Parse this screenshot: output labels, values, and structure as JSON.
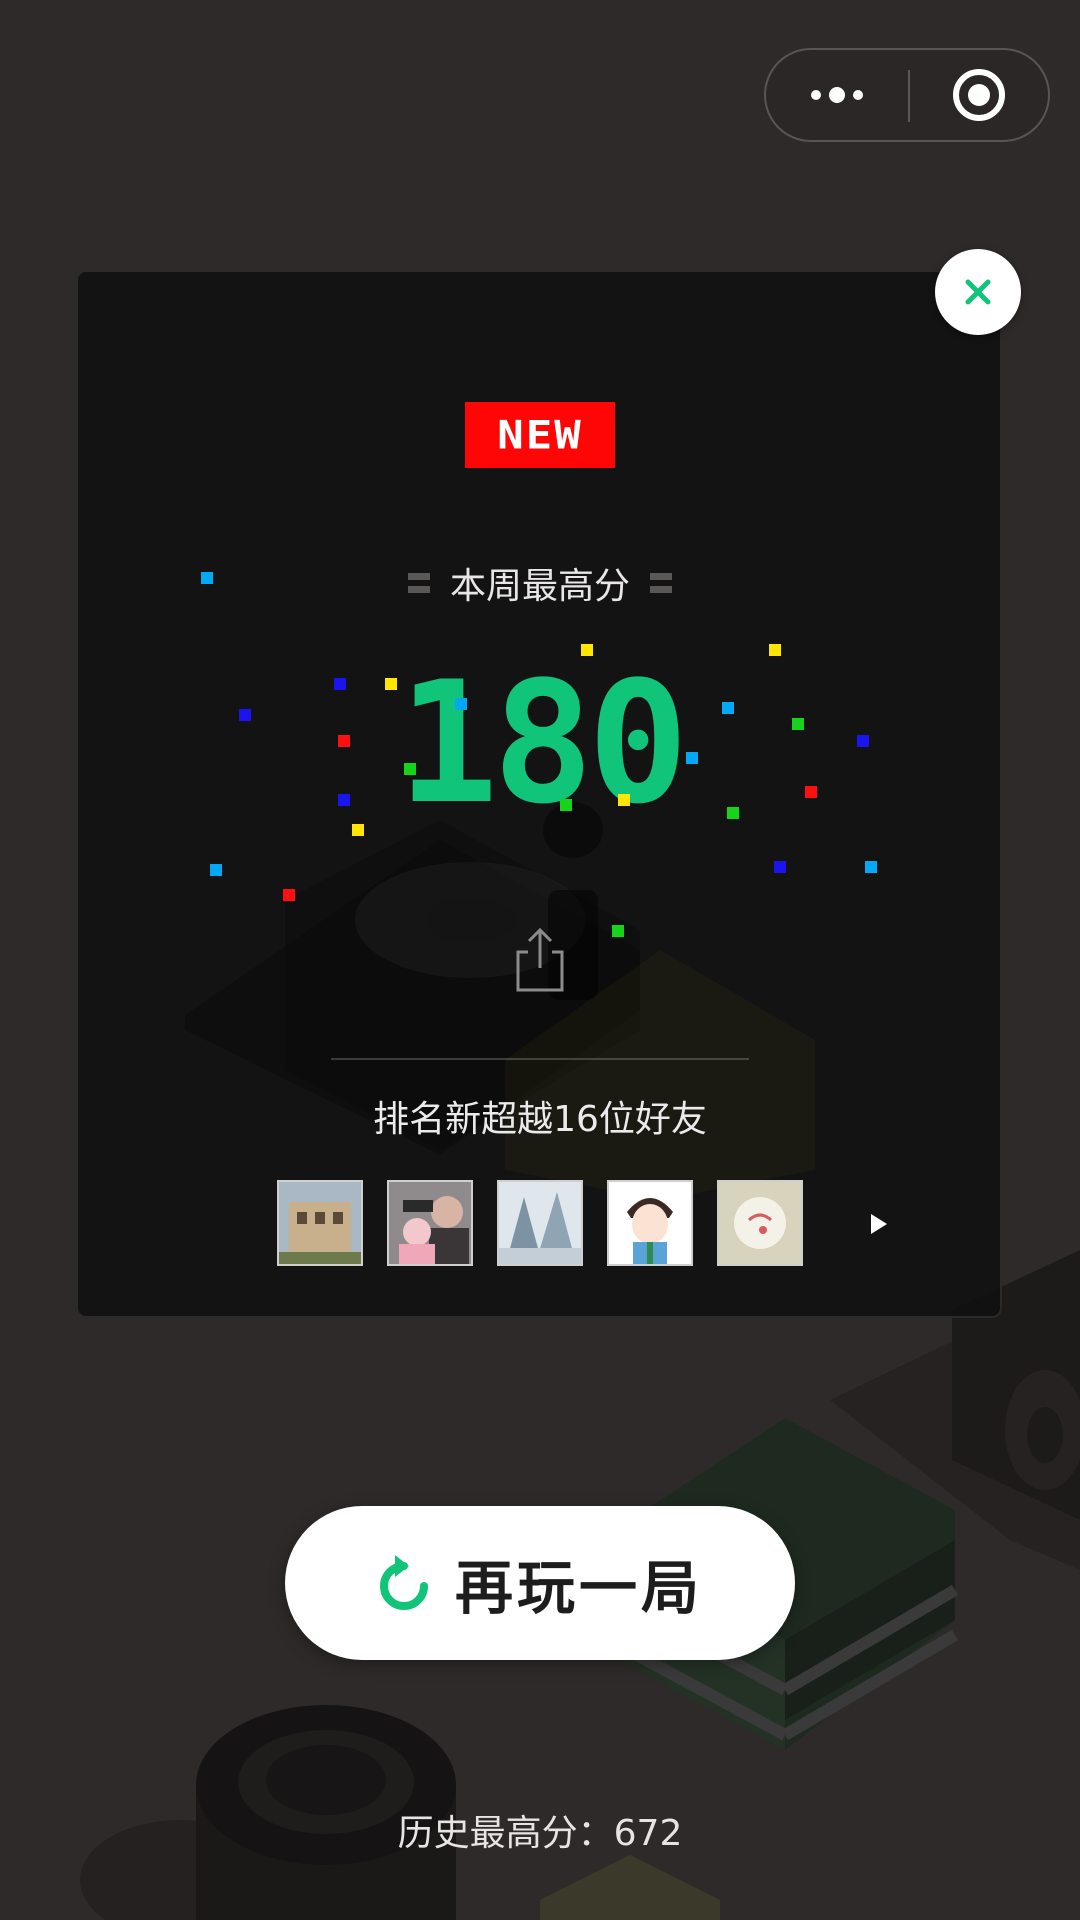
{
  "capsule": {
    "more_icon": "more-dots-icon",
    "target_icon": "target-icon"
  },
  "panel": {
    "close_icon": "close-icon",
    "new_badge": "NEW",
    "subtitle": "本周最高分",
    "score": "180",
    "share_icon": "share-icon",
    "rank_text": "排名新超越16位好友",
    "friends": [
      {
        "name": "friend-avatar-1",
        "colors": [
          "#9aa58a",
          "#c7b394",
          "#6c6f52"
        ]
      },
      {
        "name": "friend-avatar-2",
        "colors": [
          "#3d3a3c",
          "#f0c4c8",
          "#8a8486"
        ]
      },
      {
        "name": "friend-avatar-3",
        "colors": [
          "#cfd8df",
          "#6f8594",
          "#e8eef2"
        ]
      },
      {
        "name": "friend-avatar-4",
        "colors": [
          "#ffffff",
          "#5aa3d6",
          "#3b2a24"
        ]
      },
      {
        "name": "friend-avatar-5",
        "colors": [
          "#e9e6d6",
          "#e06a6a",
          "#d4cfb6"
        ]
      }
    ],
    "next_icon": "play-arrow-icon"
  },
  "replay": {
    "icon": "replay-icon",
    "label": "再玩一局"
  },
  "history": {
    "text": "历史最高分：672"
  },
  "colors": {
    "score_green": "#10c57a",
    "badge_red": "#ff0606",
    "background": "#2f2a2a"
  }
}
